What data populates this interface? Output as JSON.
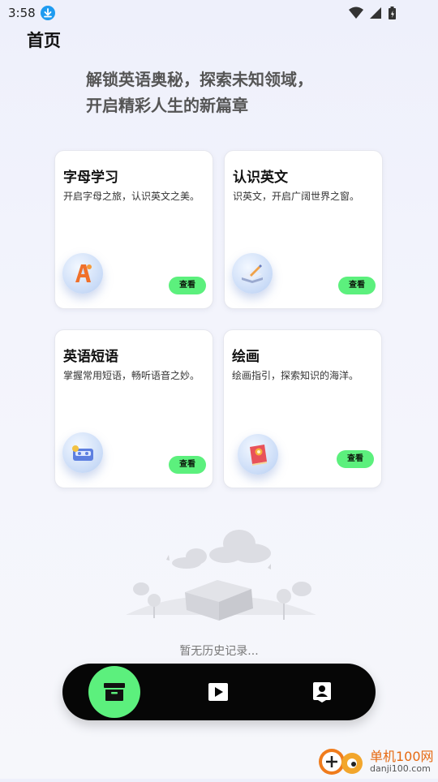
{
  "status_bar": {
    "time": "3:58",
    "download_icon": "download-icon",
    "right_icons": [
      "wifi-icon",
      "signal-icon",
      "battery-icon"
    ]
  },
  "page": {
    "title": "首页"
  },
  "hero": {
    "line1": "解锁英语奥秘，探索未知领域，",
    "line2": "开启精彩人生的新篇章"
  },
  "cards": [
    {
      "title": "字母学习",
      "desc": "开启字母之旅，认识英文之美。",
      "button": "查看",
      "icon": "letter-a-icon"
    },
    {
      "title": "认识英文",
      "desc": "识英文，开启广阔世界之窗。",
      "button": "查看",
      "icon": "book-pen-icon"
    },
    {
      "title": "英语短语",
      "desc": "掌握常用短语，畅听语音之妙。",
      "button": "查看",
      "icon": "cassette-icon"
    },
    {
      "title": "绘画",
      "desc": "绘画指引，探索知识的海洋。",
      "button": "查看",
      "icon": "paint-book-icon"
    }
  ],
  "empty_state": {
    "text": "暂无历史记录...",
    "illustration": "empty-box-illustration"
  },
  "bottom_nav": {
    "items": [
      {
        "name": "home",
        "icon": "archive-box-icon",
        "active": true
      },
      {
        "name": "video",
        "icon": "play-icon",
        "active": false
      },
      {
        "name": "profile",
        "icon": "contact-card-icon",
        "active": false
      }
    ],
    "active_color": "#5cf07d",
    "background": "#060606"
  },
  "watermark": {
    "brand": "单机100网",
    "url": "danji100.com"
  },
  "colors": {
    "accent": "#5cf07d",
    "download_blue": "#1e9bf0"
  }
}
